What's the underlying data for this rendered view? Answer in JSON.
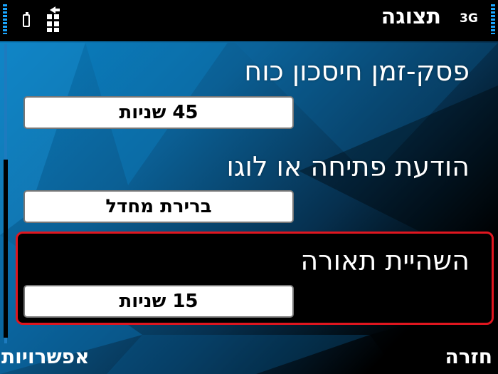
{
  "status_bar": {
    "title": "תצוגה",
    "network": "3G",
    "icons": [
      "battery-icon",
      "usb-connection-icon",
      "signal-strength-icon",
      "battery-level-icon"
    ]
  },
  "settings": [
    {
      "label": "פסק-זמן חיסכון כוח",
      "value": "45 שניות",
      "selected": false
    },
    {
      "label": "הודעת פתיחה או לוגו",
      "value": "ברירת מחדל",
      "selected": false
    },
    {
      "label": "השהיית תאורה",
      "value": "15 שניות",
      "selected": true
    }
  ],
  "softkeys": {
    "left": "אפשרויות",
    "right": "חזרה"
  },
  "colors": {
    "highlight_border": "#e0161f",
    "accent": "#1aa6ff",
    "background_dark": "#000000"
  }
}
